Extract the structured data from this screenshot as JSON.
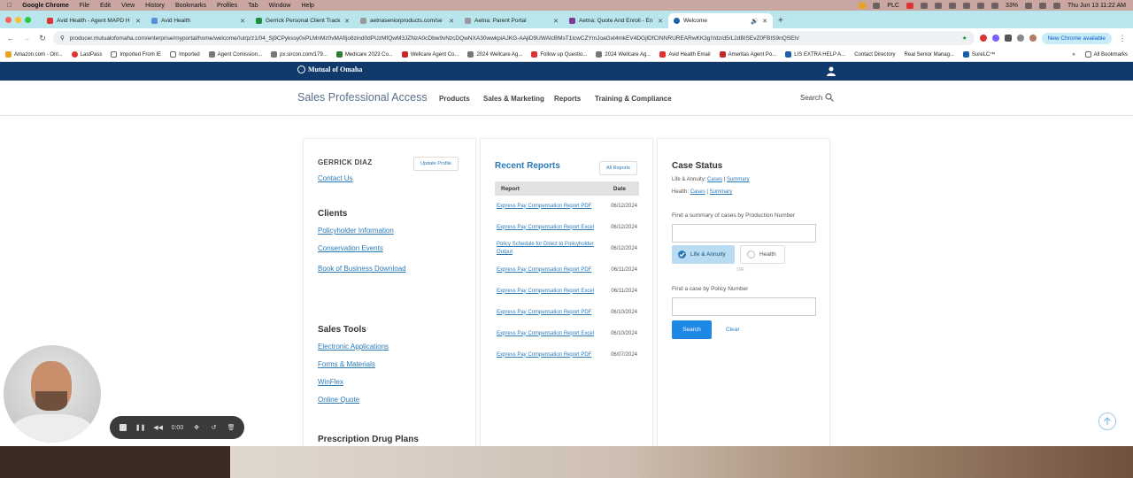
{
  "menubar": {
    "app": "Google Chrome",
    "items": [
      "File",
      "Edit",
      "View",
      "History",
      "Bookmarks",
      "Profiles",
      "Tab",
      "Window",
      "Help"
    ],
    "status": [
      "PLC",
      "33%",
      "Thu Jun 13  11:22 AM"
    ]
  },
  "tabs": [
    {
      "label": "Avid Health - Agent MAPD H",
      "active": false
    },
    {
      "label": "Avid Health",
      "active": false
    },
    {
      "label": "Gerrick Personal Client Track",
      "active": false
    },
    {
      "label": "aetnaseniorproducts.com/se",
      "active": false
    },
    {
      "label": "Aetna: Parent Portal",
      "active": false
    },
    {
      "label": "Aetna: Quote And Enroll - En",
      "active": false
    },
    {
      "label": "Welcome",
      "active": true
    }
  ],
  "address": {
    "url": "producer.mutualofomaha.com/enterprise/myportal/home/welcome/!ut/p/z1/04_Sj9CPykssy0xPLMnMz0vMAfIjo8zind0dPUzMfQwM3JZNzA0cDbw9vNzcDQwNXA30wwkpiAJKG-AAjiD9UWAlcBMsT1lcwCZYmJoaGxt4mkEV4DGjlDfCINNRUREARwKK3g!!/dz/d5/L2dBISEvZ0FBIS9nQSEh/",
    "new_chrome": "New Chrome available"
  },
  "bookmarks": [
    "Amazon.com - Onl...",
    "LastPass",
    "Imported From IE",
    "Imported",
    "Agent Comission...",
    "px.sircon.com/179...",
    "Medicare 2023 Co...",
    "Wellcare Agent Co...",
    "2024 Wellcare Ag...",
    "Follow up Questio...",
    "2024 Wellcare Ag...",
    "Avid Health Email",
    "Ameritas Agent Po...",
    "LIS EXTRA HELP A...",
    "Contact Directory",
    "Real Senior Manag...",
    "SureLC™"
  ],
  "all_bookmarks": "All Bookmarks",
  "site": {
    "logo": "Mutual of Omaha",
    "title": "Sales Professional Access",
    "nav": [
      "Products",
      "Sales & Marketing",
      "Reports",
      "Training & Compliance"
    ],
    "search": "Search"
  },
  "profile": {
    "name": "GERRICK DIAZ",
    "update": "Update Profile",
    "contact": "Contact Us"
  },
  "clients": {
    "heading": "Clients",
    "links": [
      "Policyholder Information",
      "Conservation Events",
      "Book of Business Download"
    ]
  },
  "sales_tools": {
    "heading": "Sales Tools",
    "links": [
      "Electronic Applications",
      "Forms & Materials",
      "WinFlex",
      "Online Quote"
    ]
  },
  "rx_heading": "Prescription Drug Plans",
  "reports": {
    "title": "Recent Reports",
    "all": "All Reports",
    "col_report": "Report",
    "col_date": "Date",
    "rows": [
      {
        "name": "Express Pay Compensation Report PDF",
        "date": "06/12/2024"
      },
      {
        "name": "Express Pay Compensation Report Excel",
        "date": "06/12/2024"
      },
      {
        "name": "Policy Schedule for Direct to Policyholder Output",
        "date": "06/12/2024"
      },
      {
        "name": "Express Pay Compensation Report PDF",
        "date": "06/11/2024"
      },
      {
        "name": "Express Pay Compensation Report Excel",
        "date": "06/11/2024"
      },
      {
        "name": "Express Pay Compensation Report PDF",
        "date": "06/10/2024"
      },
      {
        "name": "Express Pay Compensation Report Excel",
        "date": "06/10/2024"
      },
      {
        "name": "Express Pay Compensation Report PDF",
        "date": "06/07/2024"
      }
    ]
  },
  "case_status": {
    "title": "Case Status",
    "life_label": "Life & Annuity:",
    "health_label": "Health:",
    "cases": "Cases",
    "summary": "Summary",
    "production_label": "Find a summary of cases by Production Number",
    "toggle_life": "Life & Annuity",
    "toggle_health": "Health",
    "or": "OR",
    "policy_label": "Find a case by Policy Number",
    "search_btn": "Search",
    "clear": "Clear"
  },
  "recorder": {
    "time": "0:00"
  },
  "colors": {
    "header": "#0f3a6b",
    "link": "#2a7ab8",
    "primary": "#1e88e5",
    "tabstrip": "#b8e6ec"
  }
}
